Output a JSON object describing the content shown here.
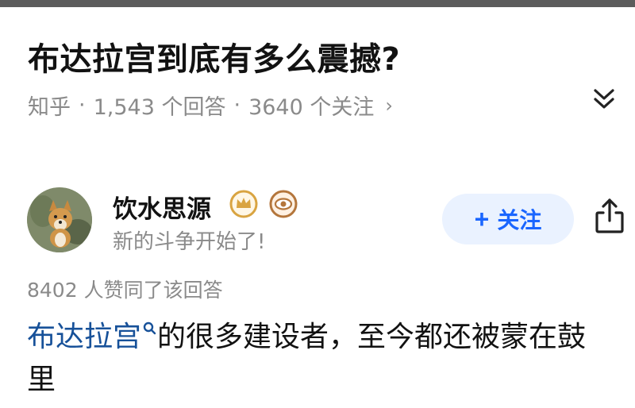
{
  "question": {
    "title": "布达拉宫到底有多么震撼?",
    "source": "知乎",
    "answers_count": "1,543 个回答",
    "followers_count": "3640 个关注",
    "chevron": "›"
  },
  "author": {
    "name": "饮水思源",
    "bio": "新的斗争开始了!",
    "follow_plus": "+",
    "follow_label": "关注"
  },
  "answer": {
    "votes_text": "8402 人赞同了该回答",
    "link_text": "布达拉宫",
    "body_text": "的很多建设者，至今都还被蒙在鼓里"
  },
  "icons": {
    "expand": "chevron-double-down-icon",
    "badge_crown": "crown-badge-icon",
    "badge_eye": "eye-badge-icon",
    "share": "share-icon",
    "search": "search-icon"
  },
  "colors": {
    "accent": "#1a66ff",
    "link": "#175199",
    "muted": "#8a8a8a",
    "follow_bg": "#eaf2ff"
  }
}
